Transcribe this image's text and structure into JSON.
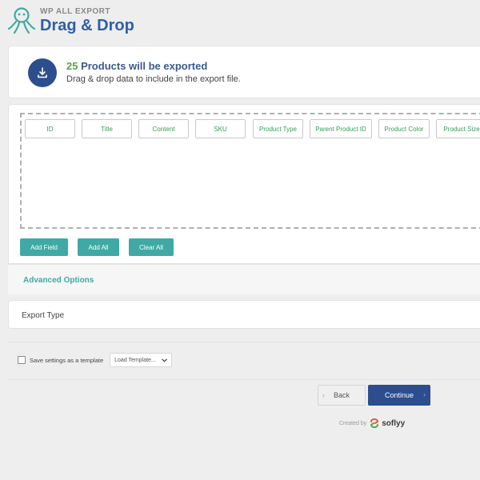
{
  "header": {
    "subtitle": "WP ALL EXPORT",
    "title": "Drag & Drop"
  },
  "summary": {
    "count": "25",
    "count_suffix": " Products will be exported",
    "subtext": "Drag & drop data to include in the export file."
  },
  "fields": [
    "ID",
    "Title",
    "Content",
    "SKU",
    "Product Type",
    "Parent Product ID",
    "Product Color",
    "Product Size"
  ],
  "actions": {
    "add_field": "Add Field",
    "add_all": "Add All",
    "clear_all": "Clear All"
  },
  "advanced_options": "Advanced Options",
  "export_type": "Export Type",
  "template": {
    "checkbox_label": "Save settings as a template",
    "select_placeholder": "Load Template...",
    "checked": false
  },
  "nav": {
    "back": "Back",
    "continue": "Continue"
  },
  "credit": {
    "created_by": "Created by",
    "name": "soflyy"
  },
  "colors": {
    "accent_teal": "#40a9a3",
    "brand_blue": "#2c4d8e",
    "count_green": "#5aa34a",
    "field_text": "#3a9a5a"
  },
  "icons": {
    "logo": "octopus-logo-icon",
    "download": "download-icon",
    "back": "chevron-left-icon",
    "continue": "chevron-right-icon",
    "select": "chevron-down-icon",
    "soflyy": "soflyy-logo-icon"
  }
}
